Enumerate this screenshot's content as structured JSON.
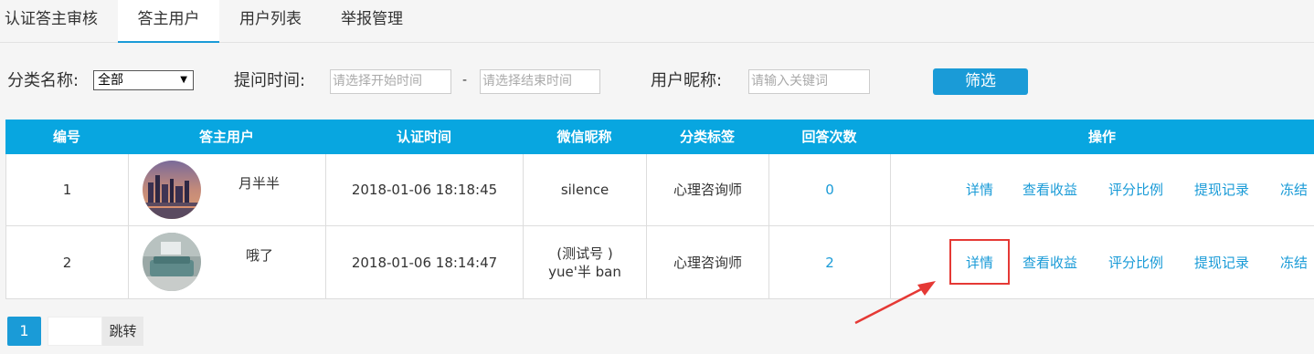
{
  "tabs": [
    {
      "label": "认证答主审核"
    },
    {
      "label": "答主用户"
    },
    {
      "label": "用户列表"
    },
    {
      "label": "举报管理"
    }
  ],
  "filters": {
    "category_label": "分类名称:",
    "category_value": "全部",
    "time_label": "提问时间:",
    "start_placeholder": "请选择开始时间",
    "separator": "-",
    "end_placeholder": "请选择结束时间",
    "nickname_label": "用户昵称:",
    "nickname_placeholder": "请输入关键词",
    "filter_button": "筛选"
  },
  "table": {
    "headers": [
      "编号",
      "答主用户",
      "认证时间",
      "微信昵称",
      "分类标签",
      "回答次数",
      "操作"
    ],
    "rows": [
      {
        "id": "1",
        "user": "月半半",
        "cert_time": "2018-01-06 18:18:45",
        "wechat_line1": "silence",
        "wechat_line2": "",
        "tag": "心理咨询师",
        "answers": "0"
      },
      {
        "id": "2",
        "user": "哦了",
        "cert_time": "2018-01-06 18:14:47",
        "wechat_line1": "(测试号 )",
        "wechat_line2": "yue'半 ban",
        "tag": "心理咨询师",
        "answers": "2"
      }
    ],
    "actions": [
      "详情",
      "查看收益",
      "评分比例",
      "提现记录",
      "冻结"
    ]
  },
  "pager": {
    "current": "1",
    "jump_label": "跳转"
  },
  "colors": {
    "accent": "#1a9bd7",
    "header_bg": "#08a6e0",
    "highlight": "#e53935"
  }
}
